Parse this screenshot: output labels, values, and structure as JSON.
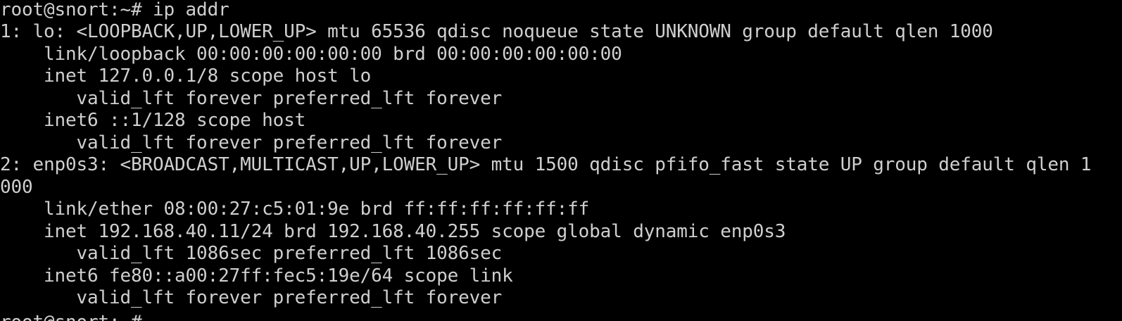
{
  "terminal": {
    "background": "#000000",
    "foreground": "#cfcfcf",
    "lines": [
      "root@snort:~# ip addr",
      "1: lo: <LOOPBACK,UP,LOWER_UP> mtu 65536 qdisc noqueue state UNKNOWN group default qlen 1000",
      "    link/loopback 00:00:00:00:00:00 brd 00:00:00:00:00:00",
      "    inet 127.0.0.1/8 scope host lo",
      "       valid_lft forever preferred_lft forever",
      "    inet6 ::1/128 scope host",
      "       valid_lft forever preferred_lft forever",
      "2: enp0s3: <BROADCAST,MULTICAST,UP,LOWER_UP> mtu 1500 qdisc pfifo_fast state UP group default qlen 1",
      "000",
      "    link/ether 08:00:27:c5:01:9e brd ff:ff:ff:ff:ff:ff",
      "    inet 192.168.40.11/24 brd 192.168.40.255 scope global dynamic enp0s3",
      "       valid_lft 1086sec preferred_lft 1086sec",
      "    inet6 fe80::a00:27ff:fec5:19e/64 scope link",
      "       valid_lft forever preferred_lft forever",
      "root@snort:~#"
    ]
  }
}
